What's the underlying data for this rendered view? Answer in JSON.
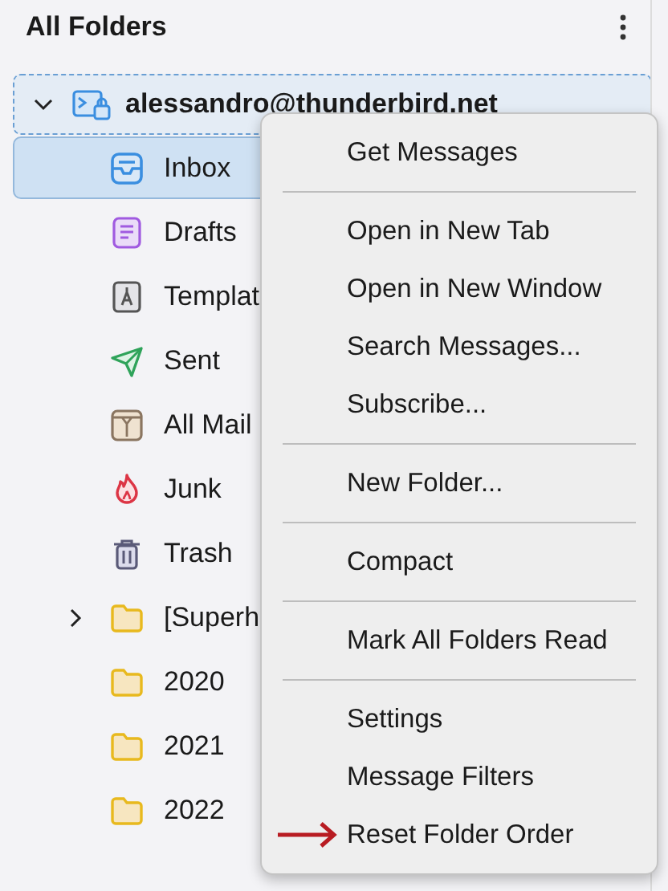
{
  "pane": {
    "title": "All Folders"
  },
  "account": {
    "name": "alessandro@thunderbird.net",
    "expanded": true,
    "focused": true
  },
  "folders": [
    {
      "name": "Inbox",
      "kind": "inbox",
      "selected": true
    },
    {
      "name": "Drafts",
      "kind": "drafts",
      "selected": false
    },
    {
      "name": "Templat",
      "kind": "templates",
      "selected": false
    },
    {
      "name": "Sent",
      "kind": "sent",
      "selected": false
    },
    {
      "name": "All Mail",
      "kind": "archive",
      "selected": false
    },
    {
      "name": "Junk",
      "kind": "junk",
      "selected": false
    },
    {
      "name": "Trash",
      "kind": "trash",
      "selected": false
    },
    {
      "name": "[Superh",
      "kind": "folder",
      "selected": false,
      "expanded": false
    },
    {
      "name": "2020",
      "kind": "folder",
      "selected": false
    },
    {
      "name": "2021",
      "kind": "folder",
      "selected": false
    },
    {
      "name": "2022",
      "kind": "folder",
      "selected": false
    }
  ],
  "context_menu": {
    "sections": [
      [
        {
          "label": "Get Messages",
          "marked": false
        }
      ],
      [
        {
          "label": "Open in New Tab",
          "marked": false
        },
        {
          "label": "Open in New Window",
          "marked": false
        },
        {
          "label": "Search Messages...",
          "marked": false
        },
        {
          "label": "Subscribe...",
          "marked": false
        }
      ],
      [
        {
          "label": "New Folder...",
          "marked": false
        }
      ],
      [
        {
          "label": "Compact",
          "marked": false
        }
      ],
      [
        {
          "label": "Mark All Folders Read",
          "marked": false
        }
      ],
      [
        {
          "label": "Settings",
          "marked": false
        },
        {
          "label": "Message Filters",
          "marked": false
        },
        {
          "label": "Reset Folder Order",
          "marked": true
        }
      ]
    ]
  }
}
